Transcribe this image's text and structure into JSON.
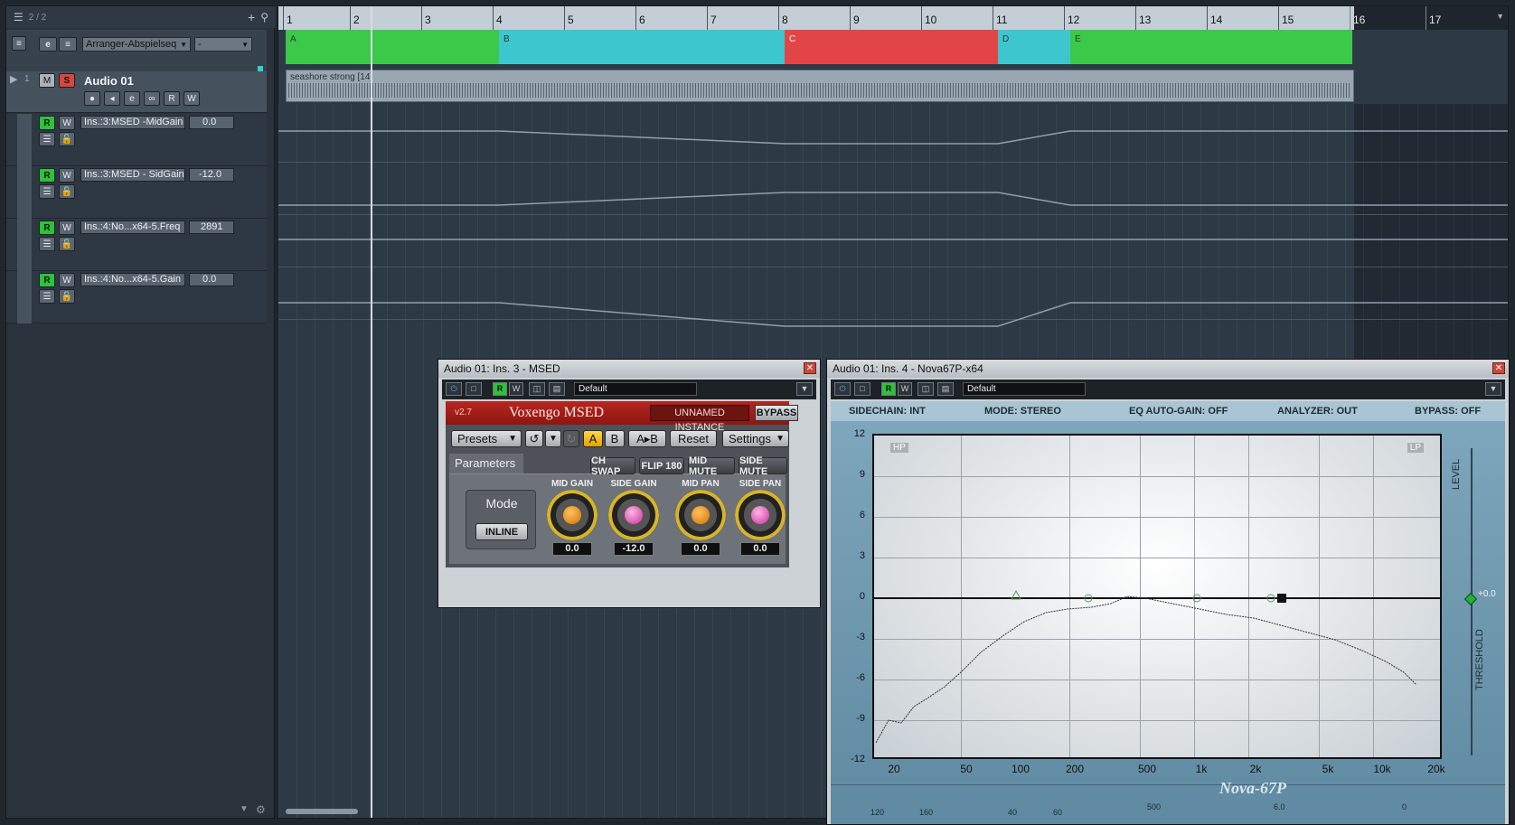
{
  "left_panel": {
    "counter": "2 / 2",
    "toolbar": {
      "mode_dropdown": "Arranger-Abspielseq",
      "second_dropdown": "-"
    },
    "track": {
      "number": "1",
      "name": "Audio 01",
      "mute": "M",
      "solo": "S",
      "read": "R",
      "write": "W"
    },
    "automation": [
      {
        "read": "R",
        "write": "W",
        "param": "Ins.:3:MSED -MidGain",
        "value": "0.0"
      },
      {
        "read": "R",
        "write": "W",
        "param": "Ins.:3:MSED - SidGain",
        "value": "-12.0"
      },
      {
        "read": "R",
        "write": "W",
        "param": "Ins.:4:No...x64-5.Freq",
        "value": "2891"
      },
      {
        "read": "R",
        "write": "W",
        "param": "Ins.:4:No...x64-5.Gain",
        "value": "0.0"
      }
    ]
  },
  "ruler": {
    "bars": [
      "1",
      "2",
      "3",
      "4",
      "5",
      "6",
      "7",
      "8",
      "9",
      "10",
      "11",
      "12",
      "13",
      "14",
      "15",
      "16",
      "17"
    ]
  },
  "arranger_events": [
    {
      "label": "A",
      "color": "#3cc94a"
    },
    {
      "label": "B",
      "color": "#3ec6cf"
    },
    {
      "label": "C",
      "color": "#e24545"
    },
    {
      "label": "D",
      "color": "#3ec6cf"
    },
    {
      "label": "E",
      "color": "#3cc94a"
    }
  ],
  "audio_clip": {
    "name": "seashore strong [14]"
  },
  "msed_window": {
    "title": "Audio 01: Ins. 3 - MSED",
    "preset": "Default",
    "version": "v2.7",
    "product": "Voxengo MSED",
    "instance": "UNNAMED INSTANCE",
    "bypass": "BYPASS",
    "toolbar": {
      "presets": "Presets",
      "a": "A",
      "b": "B",
      "ab": "A▸B",
      "reset": "Reset",
      "settings": "Settings"
    },
    "parameters_tab": "Parameters",
    "switches": [
      "CH SWAP",
      "FLIP 180",
      "MID MUTE",
      "SIDE MUTE"
    ],
    "mode": {
      "label": "Mode",
      "value": "INLINE"
    },
    "knobs": [
      {
        "label": "MID GAIN",
        "value": "0.0"
      },
      {
        "label": "SIDE GAIN",
        "value": "-12.0"
      },
      {
        "label": "MID PAN",
        "value": "0.0"
      },
      {
        "label": "SIDE PAN",
        "value": "0.0"
      }
    ]
  },
  "nova_window": {
    "title": "Audio 01: Ins. 4 - Nova67P-x64",
    "preset": "Default",
    "status": {
      "sidechain": "SIDECHAIN: INT",
      "mode": "MODE: STEREO",
      "autogain": "EQ AUTO-GAIN: OFF",
      "analyzer": "ANALYZER: OUT",
      "bypass": "BYPASS: OFF"
    },
    "hp": "HP",
    "lp": "LP",
    "level_label": "LEVEL",
    "threshold_label": "THRESHOLD",
    "threshold_value": "+0.0",
    "y_ticks": [
      "12",
      "9",
      "6",
      "3",
      "0",
      "-3",
      "-6",
      "-9",
      "-12"
    ],
    "x_ticks": [
      "20",
      "50",
      "100",
      "200",
      "500",
      "1k",
      "2k",
      "5k",
      "10k",
      "20k"
    ],
    "bottom_scale": [
      "120",
      "160",
      "40",
      "60",
      "500",
      "6.0",
      "0"
    ],
    "logo": "Nova-67P"
  }
}
